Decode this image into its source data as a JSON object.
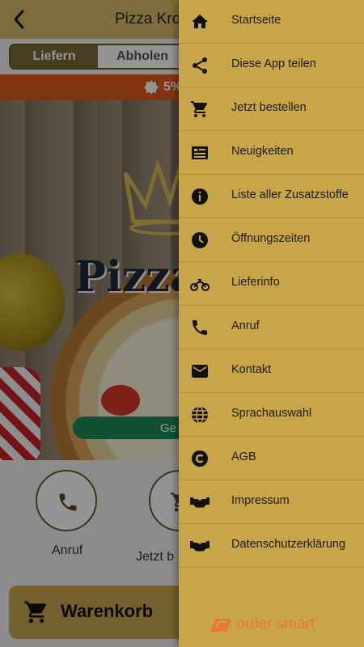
{
  "header": {
    "title": "Pizza Kron",
    "back_icon": "chevron-left-icon"
  },
  "tabs": {
    "delivery": "Liefern",
    "pickup": "Abholen"
  },
  "promo": {
    "text": "5%",
    "icon": "badge-icon"
  },
  "hero": {
    "brand_text": "Pizza",
    "opening_status": "Ge"
  },
  "quick_actions": {
    "call": "Anruf",
    "order": "Jetzt b"
  },
  "cart": {
    "label": "Warenkorb"
  },
  "drawer": {
    "items": [
      {
        "label": "Startseite",
        "icon": "home-icon"
      },
      {
        "label": "Diese App teilen",
        "icon": "share-icon"
      },
      {
        "label": "Jetzt bestellen",
        "icon": "cart-icon"
      },
      {
        "label": "Neuigkeiten",
        "icon": "news-icon"
      },
      {
        "label": "Liste aller Zusatzstoffe",
        "icon": "info-icon"
      },
      {
        "label": "Öffnungszeiten",
        "icon": "clock-icon"
      },
      {
        "label": "Lieferinfo",
        "icon": "motorcycle-icon"
      },
      {
        "label": "Anruf",
        "icon": "phone-icon"
      },
      {
        "label": "Kontakt",
        "icon": "mail-icon"
      },
      {
        "label": "Sprachauswahl",
        "icon": "globe-icon"
      },
      {
        "label": "AGB",
        "icon": "copyright-icon"
      },
      {
        "label": "Impressum",
        "icon": "handshake-icon"
      },
      {
        "label": "Datenschutzerklärung",
        "icon": "handshake-icon"
      }
    ],
    "brand": "order smart"
  },
  "colors": {
    "drawer_bg": "#c9a54a",
    "header_bg": "#d9bd6a",
    "promo_bg": "#e05a1e",
    "accent_text": "#e8773a"
  }
}
